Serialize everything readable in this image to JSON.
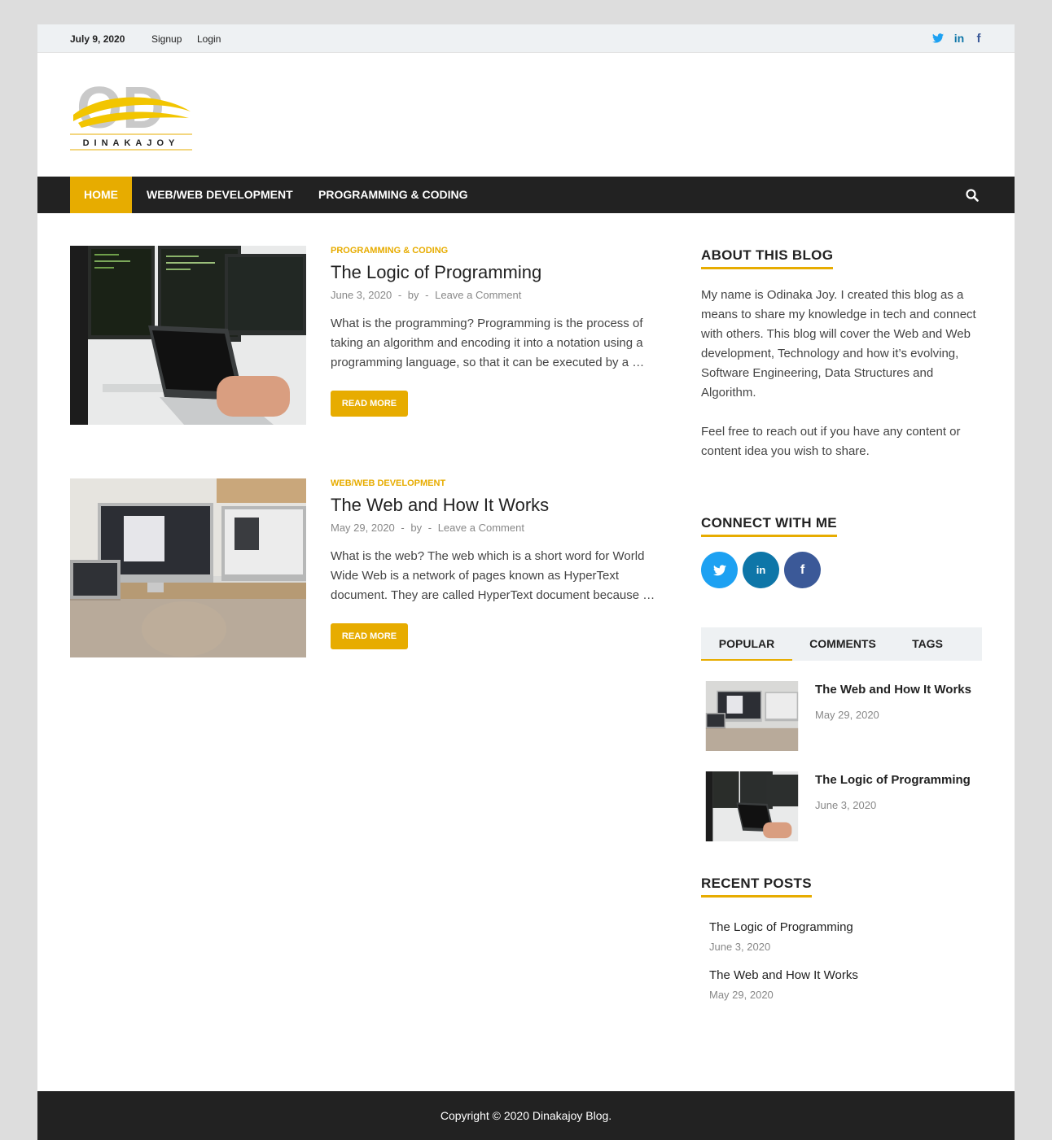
{
  "topbar": {
    "date": "July 9, 2020",
    "signup": "Signup",
    "login": "Login",
    "social_icons": [
      "twitter-icon",
      "linkedin-icon",
      "facebook-icon"
    ]
  },
  "logo": {
    "letters": "OD",
    "wordmark": "DINAKAJOY"
  },
  "nav": {
    "home": "HOME",
    "web": "WEB/WEB DEVELOPMENT",
    "programming": "PROGRAMMING & CODING"
  },
  "posts": [
    {
      "category": "PROGRAMMING & CODING",
      "title": "The Logic of Programming",
      "date": "June 3, 2020",
      "by": "by",
      "comment": "Leave a Comment",
      "excerpt": "What is the programming? Programming is the process of taking an algorithm and encoding it into a notation using a programming language, so that it can be executed by a …",
      "read_more": "READ MORE"
    },
    {
      "category": "WEB/WEB DEVELOPMENT",
      "title": "The Web and How It Works",
      "date": "May 29, 2020",
      "by": "by",
      "comment": "Leave a Comment",
      "excerpt": "What is the web? The web which is a short word for World Wide Web is a network of pages known as HyperText document. They are called HyperText document because …",
      "read_more": "READ MORE"
    }
  ],
  "sidebar": {
    "about_title": "ABOUT THIS BLOG",
    "about_p1": "My name is Odinaka Joy. I created this blog as a means to share my knowledge in tech and connect with others. This blog will cover the Web and Web development, Technology and how it’s evolving, Software Engineering, Data Structures and Algorithm.",
    "about_p2": "Feel free to reach out if you have any content or content idea you wish to share.",
    "connect_title": "CONNECT WITH ME",
    "tabs": [
      "POPULAR",
      "COMMENTS",
      "TAGS"
    ],
    "popular": [
      {
        "title": "The Web and How It Works",
        "date": "May 29, 2020"
      },
      {
        "title": "The Logic of Programming",
        "date": "June 3, 2020"
      }
    ],
    "recent_title": "RECENT POSTS",
    "recent": [
      {
        "title": "The Logic of Programming",
        "date": "June 3, 2020"
      },
      {
        "title": "The Web and How It Works",
        "date": "May 29, 2020"
      }
    ]
  },
  "footer": {
    "text": "Copyright © 2020",
    "site": "Dinakajoy Blog."
  },
  "colors": {
    "accent": "#e7ac00",
    "dark": "#222222",
    "twitter": "#1da1f2",
    "linkedin": "#0e76a8",
    "facebook": "#3b5998"
  }
}
